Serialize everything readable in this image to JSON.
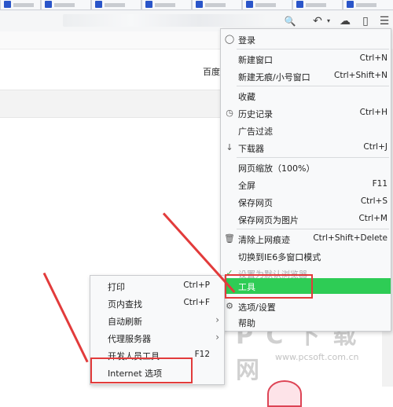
{
  "page": {
    "baidu_text": "百度"
  },
  "menu": {
    "items": [
      {
        "id": "login",
        "label": "登录",
        "shortcut": "",
        "icon": "user-icon"
      },
      {
        "id": "new-window",
        "label": "新建窗口",
        "shortcut": "Ctrl+N",
        "icon": ""
      },
      {
        "id": "new-private",
        "label": "新建无痕/小号窗口",
        "shortcut": "Ctrl+Shift+N",
        "icon": ""
      },
      {
        "id": "favorites",
        "label": "收藏",
        "shortcut": "",
        "icon": ""
      },
      {
        "id": "history",
        "label": "历史记录",
        "shortcut": "Ctrl+H",
        "icon": "clock-icon"
      },
      {
        "id": "adblock",
        "label": "广告过滤",
        "shortcut": "",
        "icon": ""
      },
      {
        "id": "downloads",
        "label": "下载器",
        "shortcut": "Ctrl+J",
        "icon": "download-arrow-icon"
      },
      {
        "id": "zoom",
        "label": "网页缩放（100%）",
        "shortcut": "",
        "icon": ""
      },
      {
        "id": "fullscreen",
        "label": "全屏",
        "shortcut": "F11",
        "icon": ""
      },
      {
        "id": "save-page",
        "label": "保存网页",
        "shortcut": "Ctrl+S",
        "icon": ""
      },
      {
        "id": "save-image",
        "label": "保存网页为图片",
        "shortcut": "Ctrl+M",
        "icon": ""
      },
      {
        "id": "clear-traces",
        "label": "清除上网痕迹",
        "shortcut": "Ctrl+Shift+Delete",
        "icon": "trash-icon"
      },
      {
        "id": "ie6-mode",
        "label": "切换到IE6多窗口模式",
        "shortcut": "",
        "icon": ""
      },
      {
        "id": "set-default",
        "label": "设置为默认浏览器",
        "shortcut": "",
        "icon": "check-icon"
      },
      {
        "id": "tools",
        "label": "工具",
        "shortcut": "",
        "icon": ""
      },
      {
        "id": "options",
        "label": "选项/设置",
        "shortcut": "",
        "icon": "gear-icon"
      },
      {
        "id": "help",
        "label": "帮助",
        "shortcut": "",
        "icon": ""
      }
    ]
  },
  "submenu": {
    "items": [
      {
        "id": "print",
        "label": "打印",
        "shortcut": "Ctrl+P",
        "arrow": ""
      },
      {
        "id": "find",
        "label": "页内查找",
        "shortcut": "Ctrl+F",
        "arrow": ""
      },
      {
        "id": "auto-refresh",
        "label": "自动刷新",
        "shortcut": "",
        "arrow": "›"
      },
      {
        "id": "proxy",
        "label": "代理服务器",
        "shortcut": "",
        "arrow": "›"
      },
      {
        "id": "devtools",
        "label": "开发人员工具",
        "shortcut": "F12",
        "arrow": ""
      },
      {
        "id": "internet-options",
        "label": "Internet 选项",
        "shortcut": "",
        "arrow": ""
      }
    ]
  },
  "watermark": {
    "text": "P C 下 载 网",
    "url": "www.pcsoft.com.cn"
  },
  "colors": {
    "highlight": "#2ecc55",
    "annotation_red": "#e23b3b",
    "disabled_text": "#a7a9ad"
  }
}
